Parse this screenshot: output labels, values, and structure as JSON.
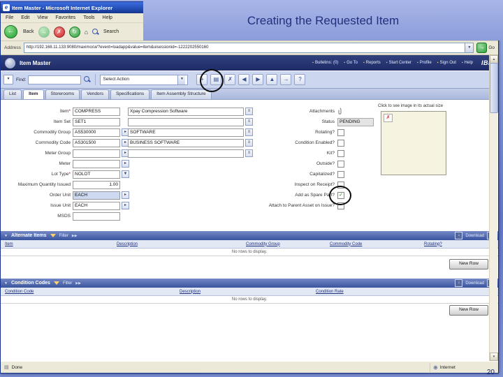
{
  "slide": {
    "title": "Creating the Requested Item",
    "page_number": "20"
  },
  "browser": {
    "window_title": "Item Master - Microsoft Internet Explorer",
    "menu": [
      "File",
      "Edit",
      "View",
      "Favorites",
      "Tools",
      "Help"
    ],
    "back_label": "Back",
    "search_label": "Search",
    "address_label": "Address",
    "url": "http://192.168.11.133:9080/maximo/ui/?event=loadapp&value=item&uisessionid=-1222202550160",
    "go_label": "Go",
    "status_done": "Done",
    "status_zone": "Internet"
  },
  "app": {
    "title": "Item Master",
    "nav_links": [
      "Bulletins: (0)",
      "Go To",
      "Reports",
      "Start Center",
      "Profile",
      "Sign Out",
      "Help"
    ],
    "brand": "IBM",
    "find_label": "Find:",
    "find_value": "",
    "select_action": "Select Action",
    "tabs": [
      "List",
      "Item",
      "Storerooms",
      "Vendors",
      "Specifications",
      "Item Assembly Structure"
    ],
    "active_tab": "Item"
  },
  "form": {
    "left_fields": [
      {
        "label": "Item",
        "required": "*",
        "value": "COMPRESS"
      },
      {
        "label": "Item Set",
        "value": "SET1"
      },
      {
        "label": "Commodity Group",
        "value": "AS530000"
      },
      {
        "label": "Commodity Code",
        "value": "AS301500"
      },
      {
        "label": "Meter Group",
        "value": ""
      },
      {
        "label": "Meter",
        "value": ""
      },
      {
        "label": "Lot Type",
        "required": "*",
        "value": "NOLOT"
      },
      {
        "label": "Maximum Quantity Issued",
        "value": "1.00"
      },
      {
        "label": "Order Unit",
        "value": "EACH"
      },
      {
        "label": "Issue Unit",
        "value": "EACH"
      },
      {
        "label": "MSDS",
        "value": ""
      }
    ],
    "description_fields": [
      {
        "value": "Xpay Compression Software"
      },
      {
        "value": ""
      },
      {
        "value": "SOFTWARE"
      },
      {
        "value": "BUSINESS SOFTWARE"
      },
      {
        "value": ""
      }
    ],
    "attachments_label": "Attachments",
    "status_label": "Status",
    "status_value": "PENDING",
    "checkboxes": [
      {
        "label": "Rotating?",
        "mark": ""
      },
      {
        "label": "Condition Enabled?",
        "mark": ""
      },
      {
        "label": "Kit?",
        "mark": ""
      },
      {
        "label": "Outside?",
        "mark": ""
      },
      {
        "label": "Capitalized?",
        "mark": ""
      },
      {
        "label": "Inspect on Receipt?",
        "mark": ""
      },
      {
        "label": "Add as Spare Part?",
        "mark": "✓"
      },
      {
        "label": "Attach to Parent Asset on Issue?",
        "mark": ""
      }
    ],
    "image_caption": "Click to see image in its actual size"
  },
  "alternate_items": {
    "title": "Alternate Items",
    "filter_label": "Filter",
    "columns": [
      "Item",
      "Description",
      "Commodity Group",
      "Commodity Code",
      "Rotating?"
    ],
    "empty_text": "No rows to display.",
    "new_row": "New Row",
    "download": "Download",
    "help": "?"
  },
  "condition_codes": {
    "title": "Condition Codes",
    "filter_label": "Filter",
    "columns": [
      "Condition Code",
      "Description",
      "Condition Rate"
    ],
    "empty_text": "No rows to display.",
    "new_row": "New Row",
    "download": "Download",
    "help": "?"
  }
}
